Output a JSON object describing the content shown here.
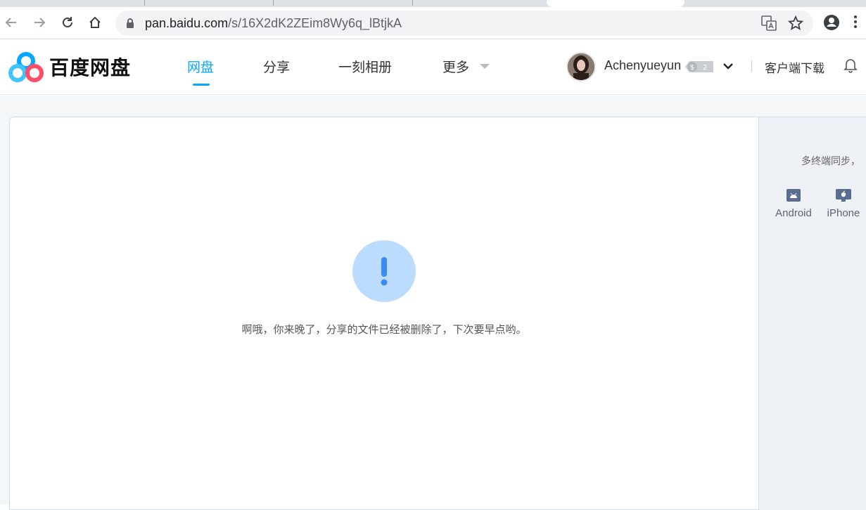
{
  "browser": {
    "url_host": "pan.baidu.com",
    "url_path": "/s/16X2dK2ZEim8Wy6q_lBtjkA"
  },
  "header": {
    "logo_text": "百度网盘",
    "nav": [
      {
        "label": "网盘"
      },
      {
        "label": "分享"
      },
      {
        "label": "一刻相册"
      },
      {
        "label": "更多"
      }
    ],
    "username": "Achenyueyun",
    "vip_level": "2",
    "client_download": "客户端下载"
  },
  "main": {
    "message": "啊哦，你来晚了，分享的文件已经被删除了，下次要早点哟。"
  },
  "side": {
    "title": "多终端同步，",
    "devices": [
      {
        "label": "Android"
      },
      {
        "label": "iPhone"
      }
    ]
  },
  "colors": {
    "accent": "#06a7ff",
    "alert_bg": "#bcdcff",
    "alert_fg": "#3a8bf5"
  }
}
